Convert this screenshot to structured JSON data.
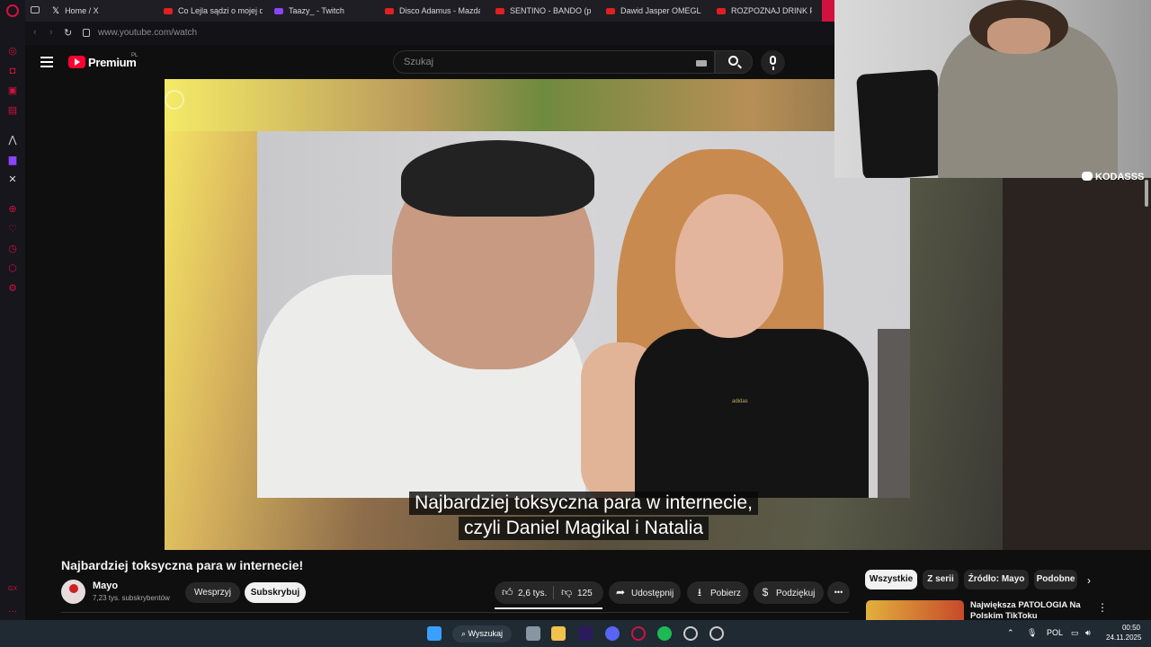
{
  "browser": {
    "tabs": [
      {
        "title": "Home / X",
        "fav": "x-icon"
      },
      {
        "title": "Co Lejla sądzi o mojej d",
        "fav": "youtube-icon"
      },
      {
        "title": "Taazy_ - Twitch",
        "fav": "twitch-icon"
      },
      {
        "title": "Disco Adamus - Mazda",
        "fav": "youtube-icon"
      },
      {
        "title": "SENTINO - BANDO (pro",
        "fav": "youtube-icon"
      },
      {
        "title": "Dawid Jasper OMEGLE",
        "fav": "youtube-icon"
      },
      {
        "title": "ROZPOZNAJ DRINK PO",
        "fav": "youtube-icon"
      }
    ],
    "url": "www.youtube.com/watch"
  },
  "youtube": {
    "logo": "Premium",
    "logo_region": "PL",
    "search_placeholder": "Szukaj"
  },
  "video": {
    "captions": [
      "Najbardziej toksyczna para w internecie,",
      "czyli Daniel Magikal i Natalia"
    ],
    "brand_on_shirt": "adidas",
    "title": "Najbardziej toksyczna para w internecie!"
  },
  "channel": {
    "name": "Mayo",
    "subscribers": "7,23 tys. subskrybentów",
    "support_label": "Wesprzyj",
    "subscribe_label": "Subskrybuj"
  },
  "actions": {
    "likes": "2,6 tys.",
    "dislikes": "125",
    "share": "Udostępnij",
    "download": "Pobierz",
    "thanks": "Podziękuj",
    "more": "•••"
  },
  "chips": [
    "Wszystkie",
    "Z serii",
    "Źródło: Mayo",
    "Podobne"
  ],
  "recommended": {
    "title": "Największa PATOLOGIA Na Polskim TikToku"
  },
  "webcam": {
    "tag": "KODASSS"
  },
  "taskbar": {
    "search_label": "Wyszukaj",
    "lang": "POL",
    "time": "00:50",
    "date": "24.11.2025"
  },
  "colors": {
    "opera_red": "#d1123f",
    "youtube_red": "#ff0033",
    "background": "#0f0f0f"
  }
}
